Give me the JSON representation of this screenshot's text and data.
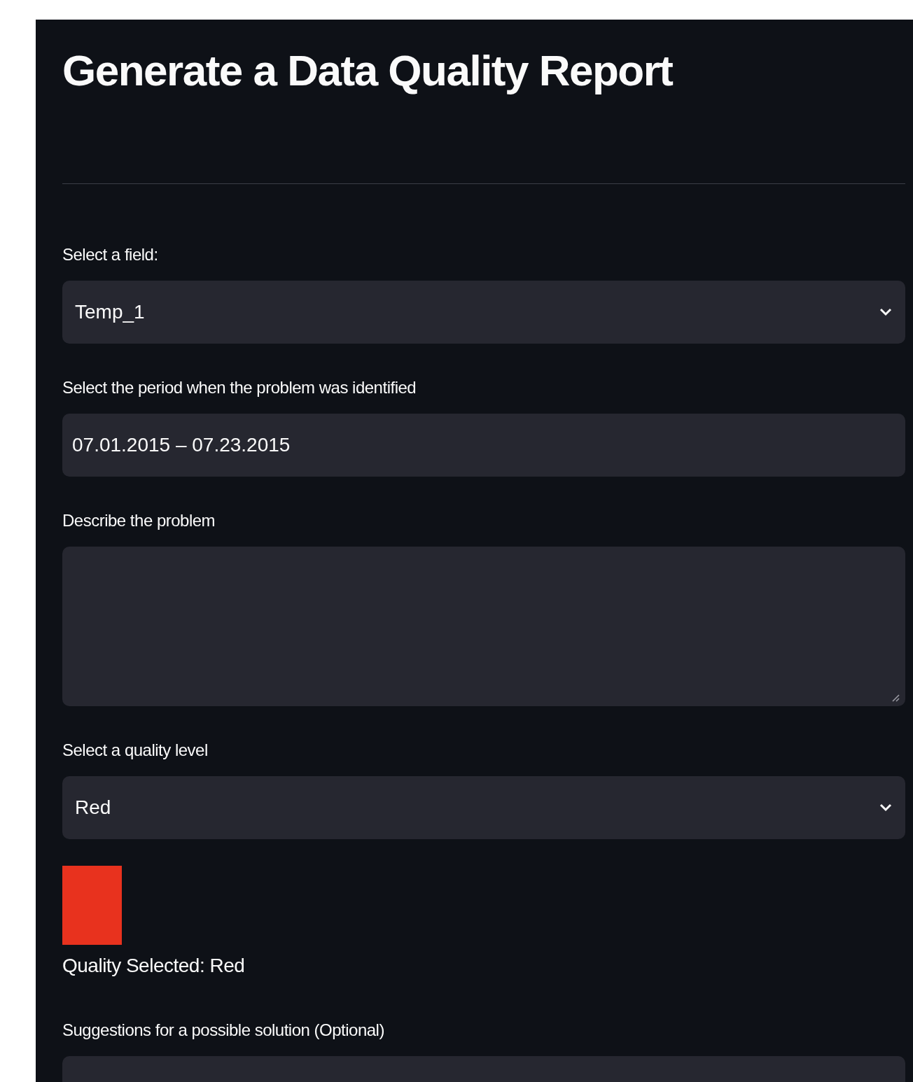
{
  "title": "Generate a Data Quality Report",
  "fields": [
    {
      "kind": "select",
      "label": "Select a field:",
      "value": "Temp_1"
    },
    {
      "kind": "date",
      "label": "Select the period when the problem was identified",
      "value": "07.01.2015 – 07.23.2015"
    },
    {
      "kind": "textarea",
      "label": "Describe the problem"
    },
    {
      "kind": "select",
      "label": "Select a quality level",
      "value": "Red"
    }
  ],
  "quality": {
    "color": "#e8321e",
    "text": "Quality Selected: Red"
  },
  "suggestions": {
    "label": "Suggestions for a possible solution (Optional)"
  }
}
